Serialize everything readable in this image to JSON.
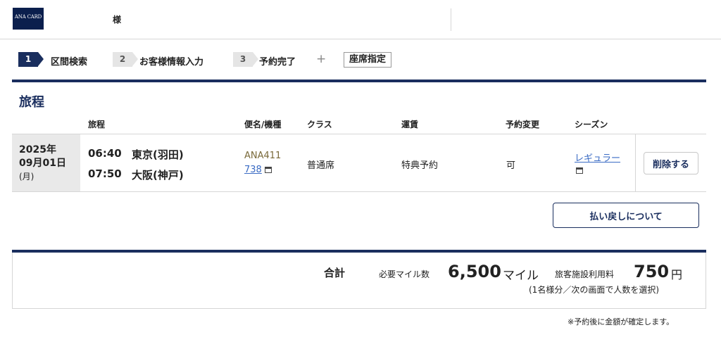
{
  "header": {
    "logo_text": "ANA CARD",
    "username": "",
    "honorific": "様"
  },
  "steps": [
    {
      "num": "1",
      "label": "区間検索",
      "active": true
    },
    {
      "num": "2",
      "label": "お客様情報入力",
      "active": false
    },
    {
      "num": "3",
      "label": "予約完了",
      "active": false
    }
  ],
  "plus_symbol": "+",
  "seat_selection_label": "座席指定",
  "itinerary": {
    "title": "旅程",
    "columns": [
      "旅程",
      "便名/機種",
      "クラス",
      "運賃",
      "予約変更",
      "シーズン"
    ],
    "row": {
      "date_year": "2025年",
      "date_monthday": "09月01日",
      "date_weekday": "(月)",
      "depart_time": "06:40",
      "depart_airport": "東京(羽田)",
      "arrive_time": "07:50",
      "arrive_airport": "大阪(神戸)",
      "flight_number": "ANA411",
      "aircraft": "738",
      "class": "普通席",
      "fare": "特典予約",
      "change": "可",
      "season": "レギュラー",
      "delete_label": "削除する"
    }
  },
  "refund_button_label": "払い戻しについて",
  "totals": {
    "label": "合計",
    "miles_label": "必要マイル数",
    "miles_value": "6,500",
    "miles_unit": "マイル",
    "fee_label": "旅客施設利用料",
    "fee_value": "750",
    "fee_unit": "円",
    "note": "(1名様分／次の画面で人数を選択)"
  },
  "footnote": "※予約後に金額が確定します。",
  "colors": {
    "navy": "#1a2e5e",
    "link": "#3a6bc4"
  }
}
